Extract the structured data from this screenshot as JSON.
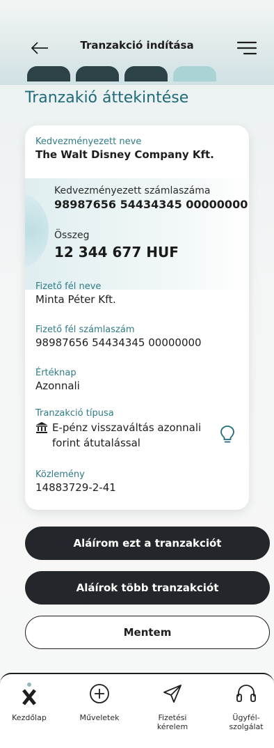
{
  "header": {
    "title": "Tranzakció indítása",
    "back_icon": "arrow-left-icon",
    "menu_icon": "hamburger-menu-icon",
    "steps": [
      {
        "active": false
      },
      {
        "active": false
      },
      {
        "active": false
      },
      {
        "active": true
      }
    ]
  },
  "section_title": "Tranzakió áttekintése",
  "card": {
    "beneficiary_name_label": "Kedvezményezett neve",
    "beneficiary_name": "The Walt Disney Company Kft.",
    "beneficiary_account_label": "Kedvezményezett számlaszáma",
    "beneficiary_account": "98987656 54434345 00000000",
    "amount_label": "Összeg",
    "amount": "12 344 677 HUF",
    "payer_name_label": "Fizető fél neve",
    "payer_name": "Minta Péter Kft.",
    "payer_account_label": "Fizető fél számlaszám",
    "payer_account": "98987656 54434345 00000000",
    "value_date_label": "Értéknap",
    "value_date": "Azonnali",
    "tx_type_label": "Tranzakció típusa",
    "tx_type": "E-pénz visszaváltás azonnali forint átutalással",
    "tx_type_icon": "bank-icon",
    "info_icon": "lightbulb-icon",
    "memo_label": "Közlemény",
    "memo": "14883729-2-41"
  },
  "buttons": {
    "sign_one": "Aláírom ezt a tranzakciót",
    "sign_many": "Aláírok több tranzakciót",
    "save": "Mentem"
  },
  "nav": {
    "items": [
      {
        "label": "Kezdőlap",
        "icon": "home-x-icon"
      },
      {
        "label": "Műveletek",
        "icon": "plus-circle-icon"
      },
      {
        "label": "Fizetési kérelem",
        "icon": "send-icon"
      },
      {
        "label": "Ügyfél-szolgálat",
        "icon": "headset-icon"
      }
    ]
  },
  "colors": {
    "accent": "#1f6b79",
    "label": "#2f7c86",
    "dark_button": "#23262a",
    "step_active": "#a9d3d5",
    "step_inactive": "#2c4246"
  }
}
